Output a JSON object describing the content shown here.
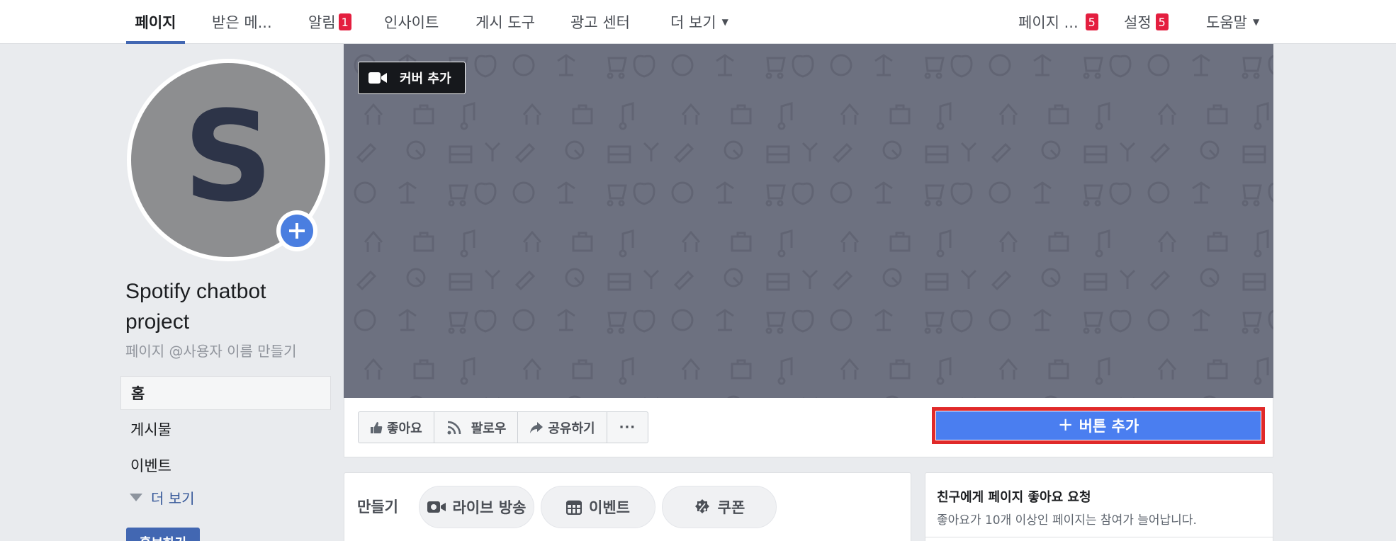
{
  "nav": {
    "left": [
      {
        "label": "페이지",
        "active": true
      },
      {
        "label": "받은 메..."
      },
      {
        "label": "알림",
        "badge": "1"
      },
      {
        "label": "인사이트"
      },
      {
        "label": "게시 도구"
      },
      {
        "label": "광고 센터"
      },
      {
        "label": "더 보기"
      }
    ],
    "right": [
      {
        "label": "페이지 ...",
        "badge": "5"
      },
      {
        "label": "설정",
        "badge": "5"
      },
      {
        "label": "도움말"
      }
    ],
    "caret": "▼"
  },
  "profile": {
    "avatar_letter": "S",
    "page_name": "Spotify chatbot project",
    "handle": "페이지 @사용자 이름 만들기"
  },
  "sidebar": {
    "items": [
      {
        "label": "홈",
        "active": true
      },
      {
        "label": "게시물"
      },
      {
        "label": "이벤트"
      }
    ],
    "more": "더 보기",
    "promote": "홍보하기"
  },
  "cover": {
    "add_cover": "커버 추가"
  },
  "actions": {
    "like": "좋아요",
    "follow": "팔로우",
    "share": "공유하기",
    "more": "···",
    "add_button": "버튼 추가",
    "add_button_plus": "+"
  },
  "create": {
    "label": "만들기",
    "live": "라이브 방송",
    "event": "이벤트",
    "coupon": "쿠폰"
  },
  "invite": {
    "title": "친구에게 페이지 좋아요 요청",
    "subtitle": "좋아요가 10개 이상인 페이지는 참여가 늘어납니다."
  },
  "colors": {
    "accent": "#4267b2",
    "button_blue": "#4a7ef0",
    "badge_red": "#e41e3f",
    "highlight_red": "#e02929",
    "cover_bg": "#6d7180"
  }
}
